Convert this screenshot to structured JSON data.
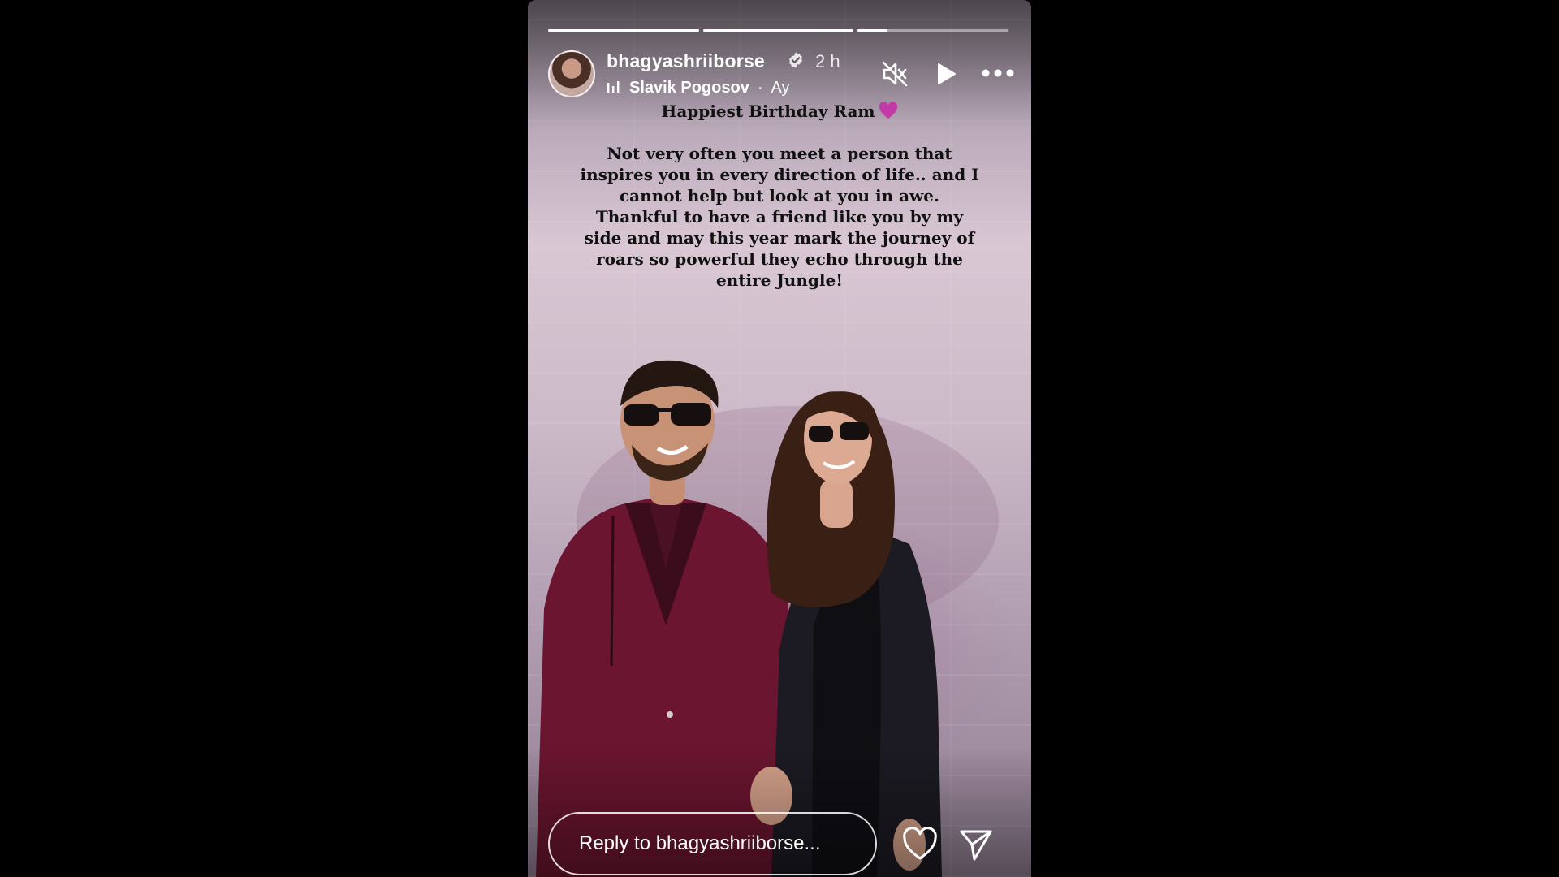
{
  "story": {
    "progress": [
      1,
      1,
      0.2
    ],
    "user": {
      "username": "bhagyashriiborse",
      "verified": true,
      "time": "2 h"
    },
    "music": {
      "artist": "Slavik Pogosov",
      "separator": "·",
      "track": "Ay"
    },
    "caption": {
      "title": "Happiest Birthday Ram",
      "emoji": "purple-heart",
      "body": "Not very often you meet a person that inspires you in every direction of life.. and I cannot help but look at you in awe. Thankful to have a friend like you by my side and may this year mark the journey of roars so powerful they echo through the entire Jungle!"
    },
    "reply_placeholder": "Reply to bhagyashriiborse...",
    "controls": {
      "mute": "muted-speaker-icon",
      "play": "play-icon",
      "more": "more-options-icon",
      "like": "heart-icon",
      "share": "send-icon"
    },
    "colors": {
      "background": "#000000",
      "text_overlay": "#ffffff",
      "caption_text": "#111111",
      "heart_emoji": "#c23aa8",
      "jacket": "#6b1530"
    }
  }
}
